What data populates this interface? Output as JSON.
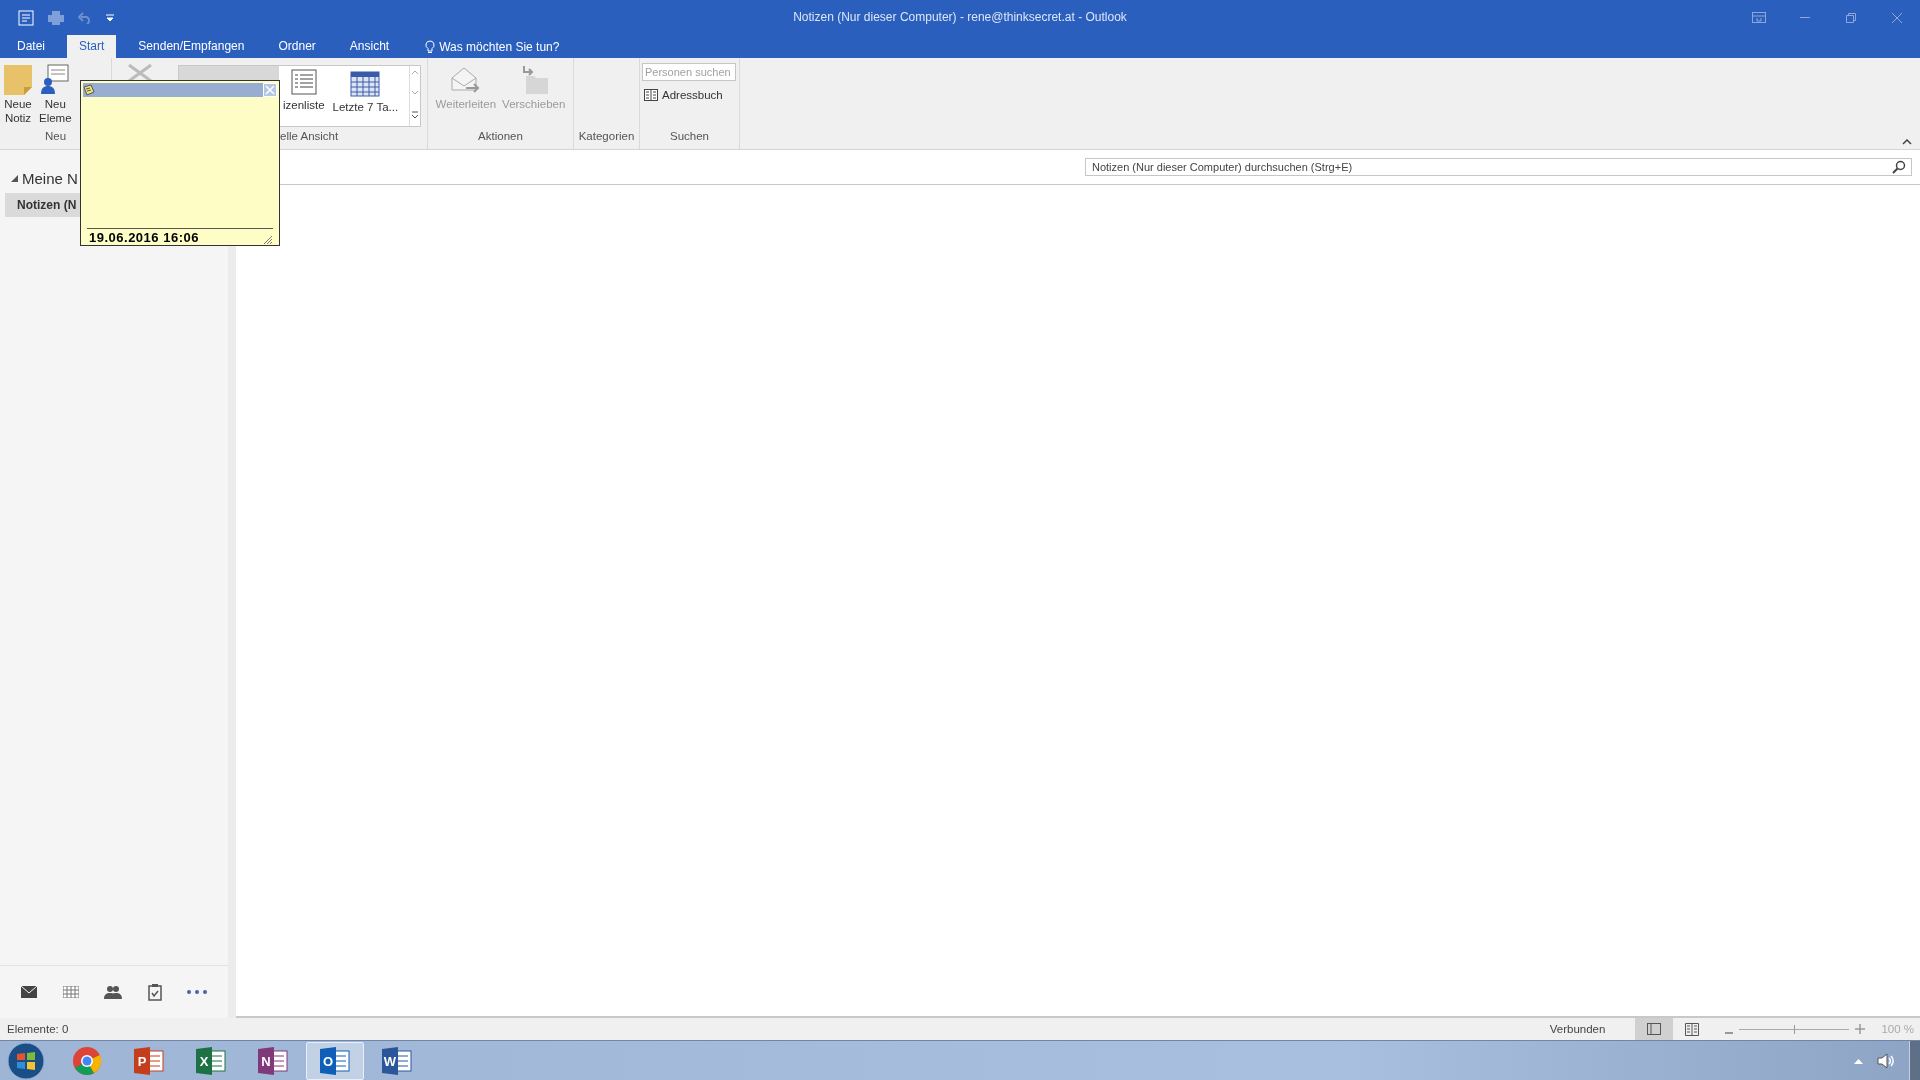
{
  "window": {
    "title": "Notizen (Nur dieser Computer) - rene@thinksecret.at - Outlook"
  },
  "tabs": [
    {
      "label": "Datei",
      "selected": false
    },
    {
      "label": "Start",
      "selected": true
    },
    {
      "label": "Senden/Empfangen",
      "selected": false
    },
    {
      "label": "Ordner",
      "selected": false
    },
    {
      "label": "Ansicht",
      "selected": false
    }
  ],
  "tell_me": {
    "label": "Was möchten Sie tun?"
  },
  "ribbon": {
    "new_group": {
      "label": "Neu",
      "buttons": [
        {
          "kind": "note",
          "lines": [
            "Neue",
            "Notiz"
          ],
          "disabled": false
        },
        {
          "kind": "item",
          "lines": [
            "Neu",
            "Eleme"
          ],
          "disabled": false
        }
      ]
    },
    "view_group": {
      "label": "elle Ansicht",
      "items": [
        {
          "kind": "list",
          "label": "izenliste",
          "selected": false
        },
        {
          "kind": "calendar",
          "label": "Letzte 7 Ta...",
          "selected": false
        }
      ]
    },
    "actions_group": {
      "label": "Aktionen",
      "buttons": [
        {
          "kind": "forward",
          "label": "Weiterleiten",
          "disabled": true
        },
        {
          "kind": "move",
          "label": "Verschieben",
          "disabled": true
        }
      ]
    },
    "categories_group": {
      "label": "Kategorien"
    },
    "search_group": {
      "label": "Suchen",
      "people_search": {
        "placeholder": "Personen suchen"
      },
      "address_book": {
        "label": "Adressbuch"
      }
    }
  },
  "navigation": {
    "header": "Meine N",
    "expanded": true,
    "items": [
      {
        "label": "Notizen (N",
        "selected": true
      }
    ],
    "buttons": [
      {
        "kind": "mail"
      },
      {
        "kind": "calendar"
      },
      {
        "kind": "people"
      },
      {
        "kind": "tasks"
      },
      {
        "kind": "more"
      }
    ]
  },
  "search": {
    "placeholder": "Notizen (Nur dieser Computer) durchsuchen (Strg+E)"
  },
  "note": {
    "date": "19.06.2016 16:06"
  },
  "status_bar": {
    "items": "Elemente: 0",
    "connection": "Verbunden",
    "views": [
      {
        "kind": "normal",
        "selected": true
      },
      {
        "kind": "reading",
        "selected": false
      }
    ],
    "zoom": {
      "level": 0.5,
      "reading": "100 %"
    }
  },
  "taskbar": {
    "apps": [
      {
        "kind": "chrome",
        "active": false
      },
      {
        "kind": "powerpoint",
        "letter": "P",
        "active": false
      },
      {
        "kind": "excel",
        "letter": "X",
        "active": false
      },
      {
        "kind": "onenote",
        "letter": "N",
        "active": false
      },
      {
        "kind": "outlook",
        "letter": "O",
        "active": true
      },
      {
        "kind": "word",
        "letter": "W",
        "active": false
      }
    ]
  }
}
